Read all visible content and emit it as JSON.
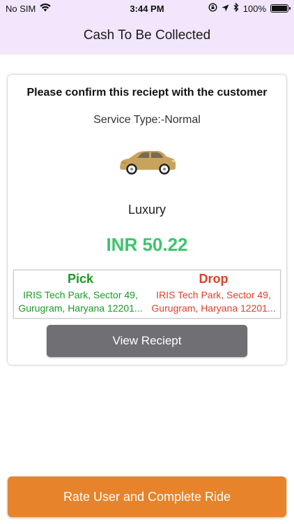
{
  "status_bar": {
    "carrier": "No SIM",
    "time": "3:44 PM",
    "battery_text": "100%",
    "battery_level": 1.0,
    "icons": [
      "wifi-icon",
      "orientation-lock-icon",
      "location-icon",
      "bluetooth-icon",
      "battery-icon"
    ]
  },
  "header": {
    "title": "Cash To Be Collected"
  },
  "card": {
    "title": "Please confirm this reciept with the customer",
    "service_type": "Service Type:-Normal",
    "vehicle_icon": "car-icon",
    "vehicle_type": "Luxury",
    "fare": "INR 50.22",
    "pick": {
      "title": "Pick",
      "address_line1": "IRIS Tech Park, Sector 49,",
      "address_line2": "Gurugram, Haryana 12201..."
    },
    "drop": {
      "title": "Drop",
      "address_line1": "IRIS Tech Park, Sector 49,",
      "address_line2": "Gurugram, Haryana 12201..."
    },
    "view_button": "View Reciept"
  },
  "footer": {
    "rate_button": "Rate User and Complete Ride"
  },
  "colors": {
    "header_bg": "#f1e6fb",
    "fare": "#3ec46d",
    "pick": "#1a9a26",
    "drop": "#e0402b",
    "view_button": "#6f6f74",
    "rate_button": "#e7832a"
  }
}
